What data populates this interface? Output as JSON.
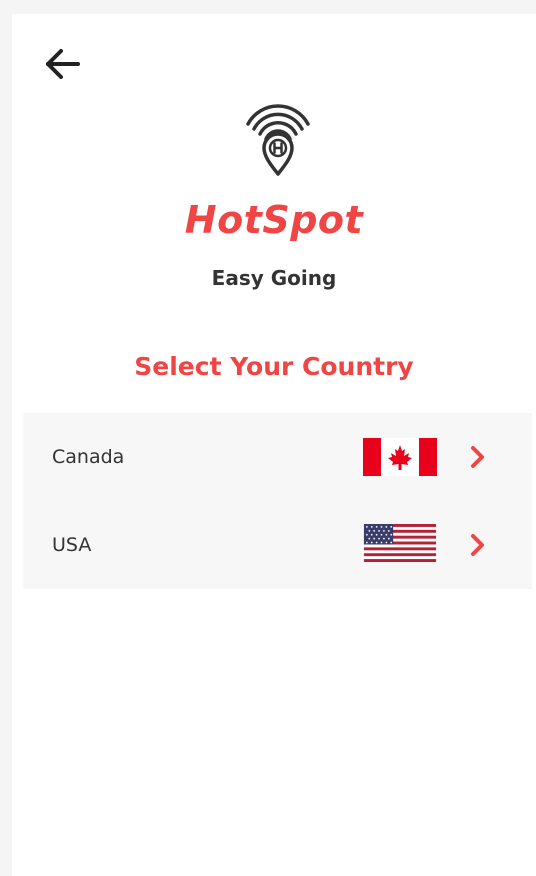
{
  "header": {
    "back_icon": "arrow-left-icon"
  },
  "brand": {
    "logo_icon": "wifi-location-pin-h-icon",
    "name": "HotSpot",
    "tagline": "Easy Going",
    "accent_color": "#f04545"
  },
  "main": {
    "title": "Select Your Country",
    "countries": [
      {
        "name": "Canada",
        "flag_icon": "canada-flag-icon",
        "chevron_icon": "chevron-right-icon"
      },
      {
        "name": "USA",
        "flag_icon": "usa-flag-icon",
        "chevron_icon": "chevron-right-icon"
      }
    ]
  }
}
